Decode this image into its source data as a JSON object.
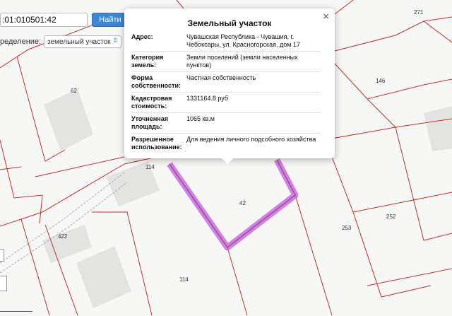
{
  "search": {
    "value": ":01:010501:42",
    "button_label": "Найти"
  },
  "filter": {
    "label": "ределение:",
    "selected": "земельный участок"
  },
  "map": {
    "parcel_labels": [
      "271",
      "62",
      "146",
      "114",
      "42",
      "422",
      "253",
      "252",
      "114"
    ],
    "highlight_color": "#b85cf0",
    "boundary_color": "#c0312b"
  },
  "popup": {
    "title": "Земельный участок",
    "close": "×",
    "rows": [
      {
        "key": "Адрес:",
        "value": "Чувашская Республика - Чувашия, г. Чебоксары, ул. Красногорская, дом 17"
      },
      {
        "key": "Категория земель:",
        "value": "Земли поселений (земли населенных пунктов)"
      },
      {
        "key": "Форма собственности:",
        "value": "Частная собственность"
      },
      {
        "key": "Кадастровая стоимость:",
        "value": "1331164.8 руб"
      },
      {
        "key": "Уточненная площадь:",
        "value": "1065 кв.м"
      },
      {
        "key": "Разрешенное использование:",
        "value": "Для ведения личного подсобного хозяйства"
      }
    ]
  }
}
